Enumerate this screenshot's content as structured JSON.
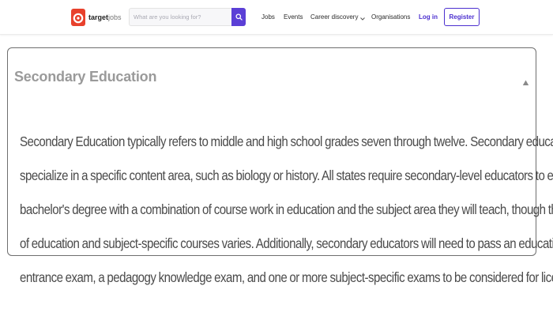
{
  "header": {
    "logo": {
      "brand": "target",
      "suffix": "jobs",
      "logo_icon": "target-logo-icon"
    },
    "search": {
      "placeholder": "What are you looking for?",
      "button_icon": "search-icon"
    },
    "nav": {
      "jobs": "Jobs",
      "events": "Events",
      "career_discovery": "Career discovery",
      "organisations": "Organisations"
    },
    "login": "Log in",
    "register": "Register"
  },
  "accordion": {
    "title": "Secondary Education",
    "toggle_icon": "caret-up-icon",
    "body_lines": [
      "Secondary Education typically refers to middle and high school grades seven through twelve. Secondary educators usually",
      "specialize in a specific content area, such as biology or history. All states require secondary-level educators to earn a",
      "bachelor's degree with a combination of course work in education and the subject area they will teach, though the number",
      "of education and subject-specific courses varies. Additionally, secondary educators will need to pass an education program",
      "entrance exam, a pedagogy knowledge exam, and one or more subject-specific exams to be considered for licensure."
    ]
  },
  "colors": {
    "brand_red": "#e8412c",
    "accent_purple": "#4b2fcf",
    "search_button": "#5b3fd6",
    "card_border": "#6e6e6e",
    "title_gray": "#9a9a9a",
    "body_text": "#4a4a4a"
  }
}
